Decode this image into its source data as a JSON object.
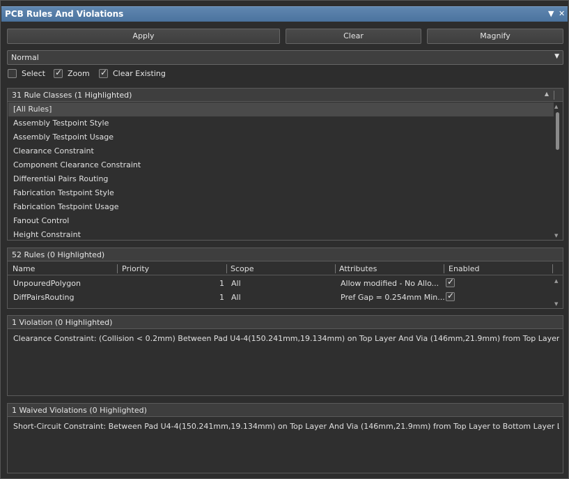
{
  "window": {
    "title": "PCB Rules And Violations",
    "menu_icon": "▼",
    "close_icon": "✕"
  },
  "toolbar": {
    "apply_label": "Apply",
    "clear_label": "Clear",
    "magnify_label": "Magnify"
  },
  "mode_select": {
    "value": "Normal"
  },
  "options": {
    "select": {
      "label": "Select",
      "checked": false
    },
    "zoom": {
      "label": "Zoom",
      "checked": true
    },
    "clear_existing": {
      "label": "Clear Existing",
      "checked": true
    }
  },
  "rule_classes": {
    "header": "31 Rule Classes (1 Highlighted)",
    "items": [
      "[All Rules]",
      "Assembly Testpoint Style",
      "Assembly Testpoint Usage",
      "Clearance Constraint",
      "Component Clearance Constraint",
      "Differential Pairs Routing",
      "Fabrication Testpoint Style",
      "Fabrication Testpoint Usage",
      "Fanout Control",
      "Height Constraint"
    ]
  },
  "rules": {
    "header": "52 Rules (0 Highlighted)",
    "columns": [
      "Name",
      "Priority",
      "Scope",
      "Attributes",
      "Enabled"
    ],
    "rows": [
      {
        "name": "UnpouredPolygon",
        "priority": "1",
        "scope": "All",
        "attributes": "Allow modified - No   Allo...",
        "enabled": true
      },
      {
        "name": "DiffPairsRouting",
        "priority": "1",
        "scope": "All",
        "attributes": "Pref Gap = 0.254mm    Min...",
        "enabled": true
      }
    ]
  },
  "violations": {
    "header": "1 Violation (0 Highlighted)",
    "items": [
      "Clearance Constraint: (Collision < 0.2mm) Between Pad U4-4(150.241mm,19.134mm) on Top Layer And Via (146mm,21.9mm) from Top Layer to Bottom Layer"
    ]
  },
  "waived": {
    "header": "1 Waived Violations (0 Highlighted)",
    "items": [
      "Short-Circuit Constraint: Between Pad U4-4(150.241mm,19.134mm) on Top Layer And Via (146mm,21.9mm) from Top Layer to Bottom Layer Location : [X =..."
    ]
  },
  "colors": {
    "title_bar": "#5078a3",
    "panel_bg": "#2d2d2d",
    "selected_row": "#4a4a4a"
  }
}
